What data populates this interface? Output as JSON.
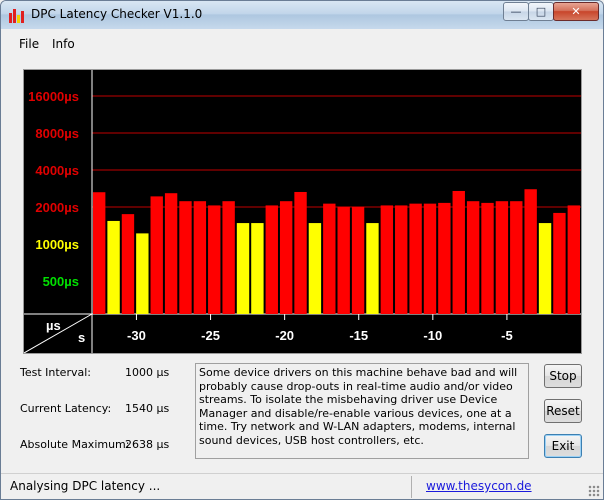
{
  "window": {
    "title": "DPC Latency Checker V1.1.0",
    "controls": {
      "minimize": "—",
      "maximize": "□",
      "close": "✕"
    }
  },
  "menu": {
    "items": [
      "File",
      "Info"
    ]
  },
  "chart_data": {
    "type": "bar",
    "y_tick_labels": [
      {
        "label": "16000µs",
        "color": "#e00000"
      },
      {
        "label": "8000µs",
        "color": "#e00000"
      },
      {
        "label": "4000µs",
        "color": "#e00000"
      },
      {
        "label": "2000µs",
        "color": "#e00000"
      },
      {
        "label": "1000µs",
        "color": "#ffff00"
      },
      {
        "label": "500µs",
        "color": "#00e000"
      }
    ],
    "axis_unit_y": "µs",
    "axis_unit_x": "s",
    "x_tick_labels": [
      "-30",
      "-25",
      "-20",
      "-15",
      "-10",
      "-5"
    ],
    "x_range": [
      -33,
      0
    ],
    "y_scale": "log2",
    "bar_colors": {
      "red": "#ff0000",
      "yellow": "#ffff00"
    },
    "values_us": [
      2638,
      1540,
      1750,
      1220,
      2440,
      2590,
      2230,
      2230,
      2060,
      2230,
      1480,
      1480,
      2060,
      2230,
      2650,
      1480,
      2130,
      2010,
      2010,
      1480,
      2060,
      2060,
      2130,
      2130,
      2160,
      2700,
      2230,
      2160,
      2230,
      2230,
      2790,
      1480,
      1790,
      2060
    ],
    "colors": [
      "red",
      "yellow",
      "red",
      "yellow",
      "red",
      "red",
      "red",
      "red",
      "red",
      "red",
      "yellow",
      "yellow",
      "red",
      "red",
      "red",
      "yellow",
      "red",
      "red",
      "red",
      "yellow",
      "red",
      "red",
      "red",
      "red",
      "red",
      "red",
      "red",
      "red",
      "red",
      "red",
      "red",
      "yellow",
      "red",
      "red"
    ],
    "grid": true
  },
  "stats": {
    "test_interval_label": "Test Interval:",
    "test_interval_value": "1000 µs",
    "current_latency_label": "Current Latency:",
    "current_latency_value": "1540 µs",
    "absolute_maximum_label": "Absolute Maximum:",
    "absolute_maximum_value": "2638 µs"
  },
  "message": "Some device drivers on this machine behave bad and will probably cause drop-outs in real-time audio and/or video streams. To isolate the misbehaving driver use Device Manager and disable/re-enable various devices, one at a time. Try network and W-LAN adapters, modems, internal sound devices, USB host controllers, etc.",
  "buttons": {
    "stop": "Stop",
    "reset": "Reset",
    "exit": "Exit"
  },
  "status": {
    "text": "Analysing DPC latency ...",
    "link": "www.thesycon.de"
  }
}
